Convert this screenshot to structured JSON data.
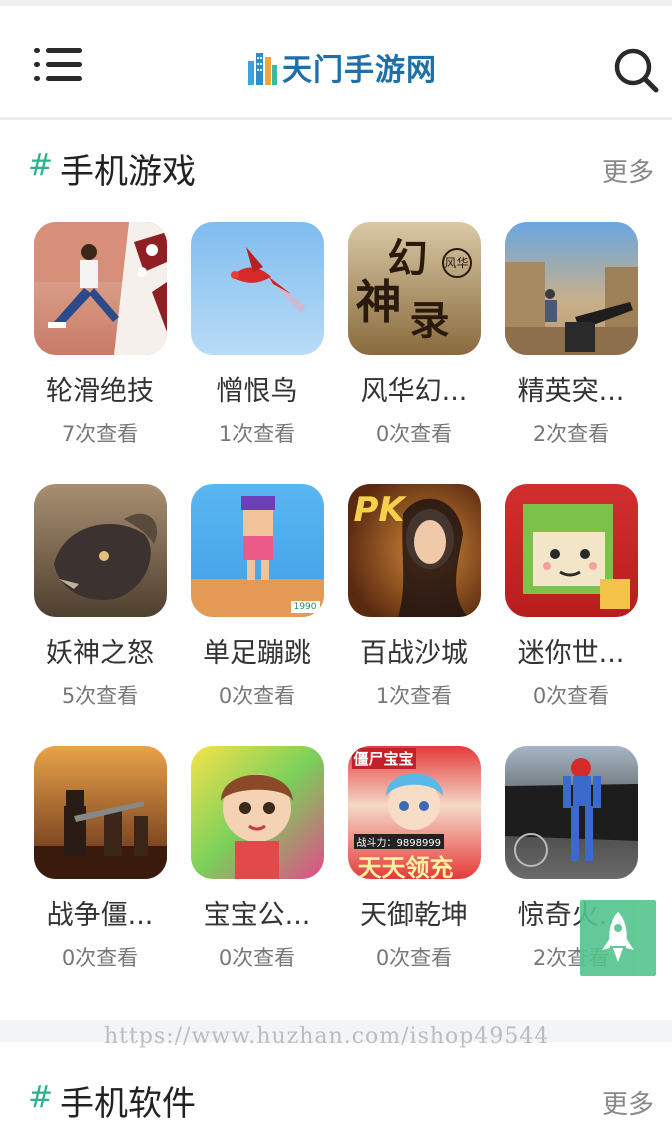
{
  "header": {
    "logo_text": "天门手游网",
    "colors": {
      "logo": "#1f6fa8",
      "accent": "#2bb38f"
    },
    "icons": {
      "menu": "menu-icon",
      "search": "search-icon"
    }
  },
  "games_section": {
    "hash": "#",
    "title": "手机游戏",
    "more_label": "更多",
    "items": [
      {
        "name": "轮滑绝技",
        "views": "7次查看"
      },
      {
        "name": "憎恨鸟",
        "views": "1次查看"
      },
      {
        "name": "风华幻...",
        "views": "0次查看"
      },
      {
        "name": "精英突...",
        "views": "2次查看"
      },
      {
        "name": "妖神之怒",
        "views": "5次查看"
      },
      {
        "name": "单足蹦跳",
        "views": "0次查看"
      },
      {
        "name": "百战沙城",
        "views": "1次查看"
      },
      {
        "name": "迷你世...",
        "views": "0次查看"
      },
      {
        "name": "战争僵...",
        "views": "0次查看"
      },
      {
        "name": "宝宝公...",
        "views": "0次查看"
      },
      {
        "name": "天御乾坤",
        "views": "0次查看"
      },
      {
        "name": "惊奇火...",
        "views": "2次查看"
      }
    ]
  },
  "thumb_text": {
    "fenghua": [
      "幻",
      "神",
      "录"
    ],
    "fenghua_badge": "风华",
    "baicang": "PK",
    "tianyu_top": "僵尸宝宝",
    "tianyu_power": "战斗力：9898999",
    "tianyu_bottom": "天天领充",
    "danzu_badge": "1990"
  },
  "watermark": "https://www.huzhan.com/ishop49544",
  "software_section": {
    "hash": "#",
    "title": "手机软件",
    "more_label": "更多"
  },
  "floating": {
    "icon": "rocket-icon",
    "color": "#54c48d"
  }
}
